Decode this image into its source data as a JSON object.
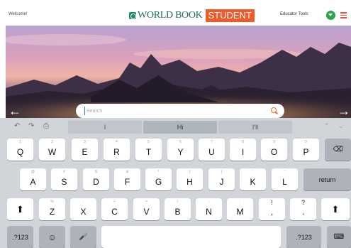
{
  "header": {
    "welcome": "Welcome!",
    "logo_text": "WORLD BOOK",
    "logo_badge": "STUDENT",
    "educator_tools": "Educator Tools",
    "user_icon": "user-circle-icon",
    "menu_icon": "hamburger-menu-icon"
  },
  "search": {
    "placeholder": "Search",
    "icon": "search-icon"
  },
  "keyboard": {
    "toolbar": {
      "undo_icon": "undo-icon",
      "redo_icon": "redo-icon",
      "paste_icon": "paste-icon",
      "suggestions": [
        "I",
        "Hi",
        "I'll"
      ],
      "up_icon": "chevron-up-icon",
      "down_icon": "chevron-down-icon"
    },
    "row1": [
      {
        "hint": "1",
        "label": "Q"
      },
      {
        "hint": "2",
        "label": "W"
      },
      {
        "hint": "3",
        "label": "E"
      },
      {
        "hint": "4",
        "label": "R"
      },
      {
        "hint": "5",
        "label": "T"
      },
      {
        "hint": "6",
        "label": "Y"
      },
      {
        "hint": "7",
        "label": "U"
      },
      {
        "hint": "8",
        "label": "I"
      },
      {
        "hint": "9",
        "label": "O"
      },
      {
        "hint": "0",
        "label": "P"
      }
    ],
    "row2": [
      {
        "hint": "@",
        "label": "A"
      },
      {
        "hint": "#",
        "label": "S"
      },
      {
        "hint": "$",
        "label": "D"
      },
      {
        "hint": "&",
        "label": "F"
      },
      {
        "hint": "*",
        "label": "G"
      },
      {
        "hint": "(",
        "label": "H"
      },
      {
        "hint": ")",
        "label": "J"
      },
      {
        "hint": "'",
        "label": "K"
      },
      {
        "hint": "\"",
        "label": "L"
      }
    ],
    "row3": [
      {
        "hint": "%",
        "label": "Z"
      },
      {
        "hint": "-",
        "label": "X"
      },
      {
        "hint": "+",
        "label": "C"
      },
      {
        "hint": "=",
        "label": "V"
      },
      {
        "hint": "/",
        "label": "B"
      },
      {
        "hint": ";",
        "label": "N"
      },
      {
        "hint": ":",
        "label": "M"
      },
      {
        "hint": "!",
        "label": ","
      },
      {
        "hint": "?",
        "label": "."
      }
    ],
    "return_label": "return",
    "numbers_label": ".?123",
    "delete_icon": "backspace-icon",
    "shift_icon": "shift-icon",
    "emoji_icon": "emoji-icon",
    "mic_icon": "microphone-icon",
    "hide_icon": "keyboard-hide-icon"
  }
}
